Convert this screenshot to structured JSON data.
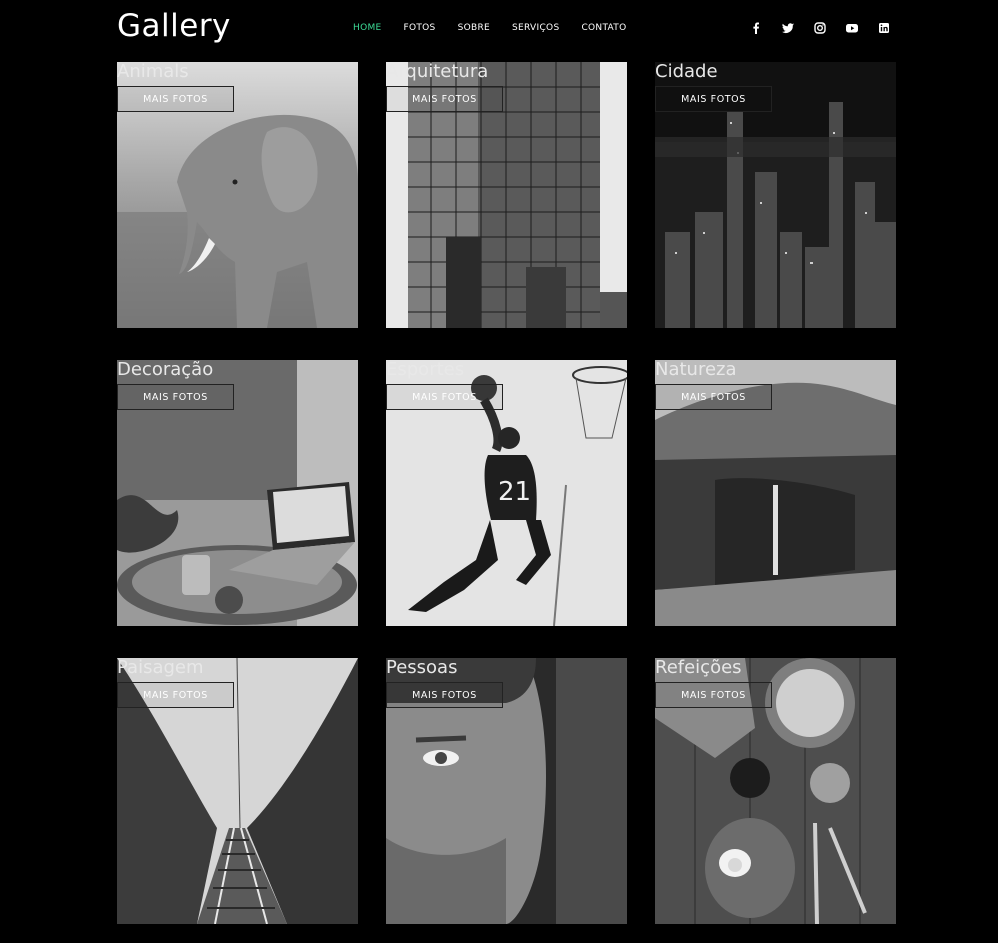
{
  "brand": {
    "logo": "Gallery"
  },
  "nav": {
    "items": [
      {
        "label": "HOME",
        "active": true
      },
      {
        "label": "FOTOS",
        "active": false
      },
      {
        "label": "SOBRE",
        "active": false
      },
      {
        "label": "SERVIÇOS",
        "active": false
      },
      {
        "label": "CONTATO",
        "active": false
      }
    ],
    "active_color": "#3ddc97"
  },
  "social": [
    "facebook-icon",
    "twitter-icon",
    "instagram-icon",
    "youtube-icon",
    "linkedin-icon"
  ],
  "gallery": {
    "button_label": "MAIS FOTOS",
    "cards": [
      {
        "title": "Animals",
        "photo": "elephant"
      },
      {
        "title": "Arquitetura",
        "photo": "building"
      },
      {
        "title": "Cidade",
        "photo": "skyline"
      },
      {
        "title": "Decoração",
        "photo": "laptop-table"
      },
      {
        "title": "Esportes",
        "photo": "basketball-player"
      },
      {
        "title": "Natureza",
        "photo": "waterfall-cliff"
      },
      {
        "title": "Paisagem",
        "photo": "railway-forest"
      },
      {
        "title": "Pessoas",
        "photo": "man-portrait"
      },
      {
        "title": "Refeições",
        "photo": "breakfast-table"
      }
    ]
  }
}
